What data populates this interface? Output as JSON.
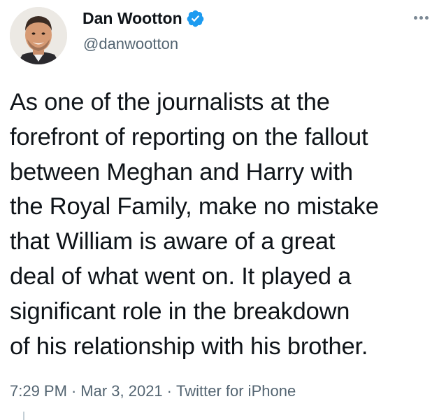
{
  "author": {
    "name": "Dan Wootton",
    "handle": "@danwootton",
    "verified": true,
    "verified_icon": "verified-badge-icon",
    "verified_color": "#1d9bf0"
  },
  "tweet": {
    "lines": [
      "As one of the journalists at the",
      "forefront of reporting on the fallout",
      "between Meghan and Harry with",
      "the Royal Family, make no mistake",
      "that William is aware of a great",
      "deal of what went on. It played a",
      "significant role in the breakdown",
      "of his relationship with his brother."
    ]
  },
  "meta": {
    "time": "7:29 PM",
    "separator": "·",
    "date": "Mar 3, 2021",
    "source": "Twitter for iPhone"
  },
  "icons": {
    "more": "more-options-icon"
  }
}
